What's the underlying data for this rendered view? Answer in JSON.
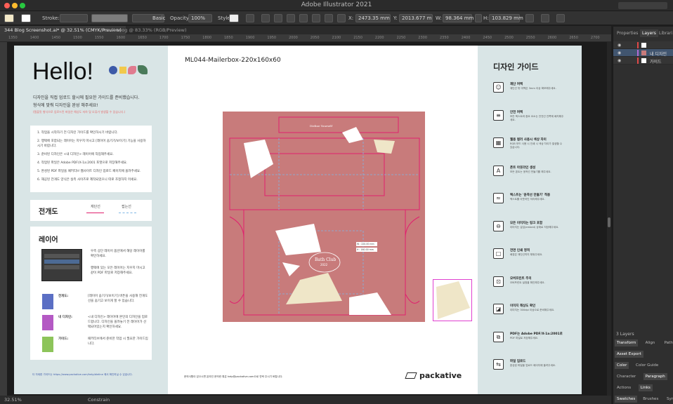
{
  "app": {
    "title": "Adobe Illustrator 2021"
  },
  "control_bar": {
    "stroke_label": "Stroke:",
    "basic_label": "Basic",
    "opacity_label": "Opacity:",
    "opacity_value": "100%",
    "style_label": "Style:",
    "x_value": "2473.35 mm",
    "y_value": "2013.677 m",
    "w_value": "98.364 mm",
    "h_value": "103.829 mm"
  },
  "tabs": [
    {
      "label": "344 Blog Screenshot.ai* @ 32.51% (CMYK/Preview)",
      "active": true
    },
    {
      "label": "Asset Loog @ 83.33% (RGB/Preview)",
      "active": false
    }
  ],
  "ruler_ticks": [
    "1350",
    "1400",
    "1450",
    "1500",
    "1550",
    "1600",
    "1650",
    "1700",
    "1750",
    "1800",
    "1850",
    "1900",
    "1950",
    "2000",
    "2050",
    "2100",
    "2150",
    "2200",
    "2250",
    "2300",
    "2350",
    "2400",
    "2450",
    "2500",
    "2550",
    "2600",
    "2650",
    "2700"
  ],
  "status": {
    "zoom": "32.51%",
    "tool": "Constrain"
  },
  "panel": {
    "tabs": [
      "Properties",
      "Layers",
      "Librari"
    ],
    "active_tab": "Layers",
    "layers": [
      {
        "name": "",
        "color": "#e04848"
      },
      {
        "name": "내 디자인",
        "color": "#b26bd6"
      },
      {
        "name": "가이드",
        "color": "#e04848"
      }
    ],
    "layers_count": "3 Layers",
    "bottom_tabs": [
      [
        "Transform",
        "Align",
        "Pathfin"
      ],
      [
        "Asset Export"
      ],
      [
        "Color",
        "Color Guide"
      ],
      [
        "Character",
        "Paragraph",
        "Op"
      ],
      [
        "Actions",
        "Links"
      ],
      [
        "Swatches",
        "Brushes",
        "Symb"
      ]
    ],
    "active_bottom": [
      "Transform",
      "Asset Export",
      "Color",
      "Paragraph",
      "Links",
      "Swatches"
    ]
  },
  "left_artboard": {
    "hello": "Hello!",
    "intro_1": "디자인을 직접 업로드 할시에 필요한 가이드를 준비했습니다.",
    "intro_2": "형식에 맞춰 디자인을 완성 해주세요!",
    "intro_red": "(템플릿 형식으로 업로드된 파일은 해상도 저하 및 오류가 발생할 수 있습니다.)",
    "steps": [
      "1. 작업을 시작하기 전 디자인 가이드를 확인하시기 바랍니다.",
      "2. 행택에 포함되는 레이어는 지우지 마시고 [레이어 숨기기/보이기] 기능을 사용하시기 바랍니다.",
      "3. 준비된 디자인은 <내 디자인> 레이어에 작업해주세요.",
      "4. 작업된 파일은 Adobe PDF(X-1a:2001 포맷으로 저장해주세요.",
      "5. 완성된 PDF 파일을 패키티브 웹사이트 디자인 업로드 페이지에 올려주세요.",
      "6. 재공된 전개도 양식은 실측 사이즈로 제작되었으니 따로 조정하지 마세요."
    ],
    "jungaedo_title": "전개도",
    "cut_line": "재단선",
    "fold_line": "접는선",
    "layer_title": "레이어",
    "layer_desc_1": "우측 상단 레이어 옵션에서 해당 레이어를 확인하세요.",
    "layer_desc_2": "행택에 있는 모든 레이어는 지우지 마시고 같이 PDF 파일로 저장해주세요.",
    "legend": [
      {
        "name": "전개도:",
        "color": "#5b6fc4",
        "desc": "[레이어 숨기기/보이기] 버튼을 사용해 전개도 선을 숨기고 보이게 할 수 있습니다."
      },
      {
        "name": "내 디자인:",
        "color": "#b459c4",
        "desc": "<내 디자인> 레이어에 본인의 디자인을 업로드합니다. 디자인을 올려놓기 전 레이어가 선택되어있는지 확인하세요."
      },
      {
        "name": "가이드:",
        "color": "#8dc45a",
        "desc": "패키티브에서 준비한 작업 시 필요한 가이드입니다."
      }
    ],
    "footer_link": "더 자세한 가이드는 https://www.packative.com/help/dieline 에서 확인하실 수 있습니다."
  },
  "center_artboard": {
    "title": "ML044-Mailerbox-220x160x60",
    "text_box_top": "Dieline Yourself",
    "bath_club": "Bath Club",
    "bath_year": "2022",
    "dim_1": "W : 220.00 mm",
    "dim_2": "H : 160.00 mm",
    "footer_note": "문의사항이 있으시면 온라인 문의란 혹은 help@packative.com으로 연락 주시기 바랍니다.",
    "logo_text": "packative"
  },
  "right_artboard": {
    "title": "디자인 가이드",
    "items": [
      {
        "icon": "☺",
        "title": "재단 여백",
        "desc": "재단선 밖 여백은 3mm 이상 확보해주세요."
      },
      {
        "icon": "≡",
        "title": "안전 여백",
        "desc": "모든 텍스트와 중요 요소는 안전선 안쪽에 배치해주세요."
      },
      {
        "icon": "▦",
        "title": "웹용 컬러 사용시 색상 차이",
        "desc": "RGB 모드 사용 시 인쇄 시 색상 차이가 발생할 수 있습니다."
      },
      {
        "icon": "A",
        "title": "폰트 아웃라인 생성",
        "desc": "모든 폰트는 윤곽선 만들기를 해주세요."
      },
      {
        "icon": "≈",
        "title": "텍스트는 '윤곽선 만들기' 적용",
        "desc": "텍스트를 아웃라인 처리해주세요."
      },
      {
        "icon": "⊖",
        "title": "모든 이미지는 링크 포함",
        "desc": "이미지는 삽입(embed) 상태로 저장해주세요."
      },
      {
        "icon": "□",
        "title": "전면 인쇄 영역",
        "desc": "배경은 재단선까지 채워주세요."
      },
      {
        "icon": "⊡",
        "title": "오버프린트 주의",
        "desc": "오버프린트 설정을 확인해주세요."
      },
      {
        "icon": "◪",
        "title": "이미지 해상도 확인",
        "desc": "이미지는 300dpi 이상으로 준비해주세요."
      },
      {
        "icon": "⧉",
        "title": "PDF는 Adobe PDF/X-1a:2001로",
        "desc": "PDF 파일로 저장해주세요."
      },
      {
        "icon": "⇆",
        "title": "파일 업로드",
        "desc": "완성된 파일을 업로드 페이지에 올려주세요."
      }
    ]
  },
  "colors": {
    "dieline_bg": "#c87b7b",
    "cut_line": "#e0206e",
    "fold_line": "#7fb7e6",
    "shape_cream": "#efe6c8"
  }
}
